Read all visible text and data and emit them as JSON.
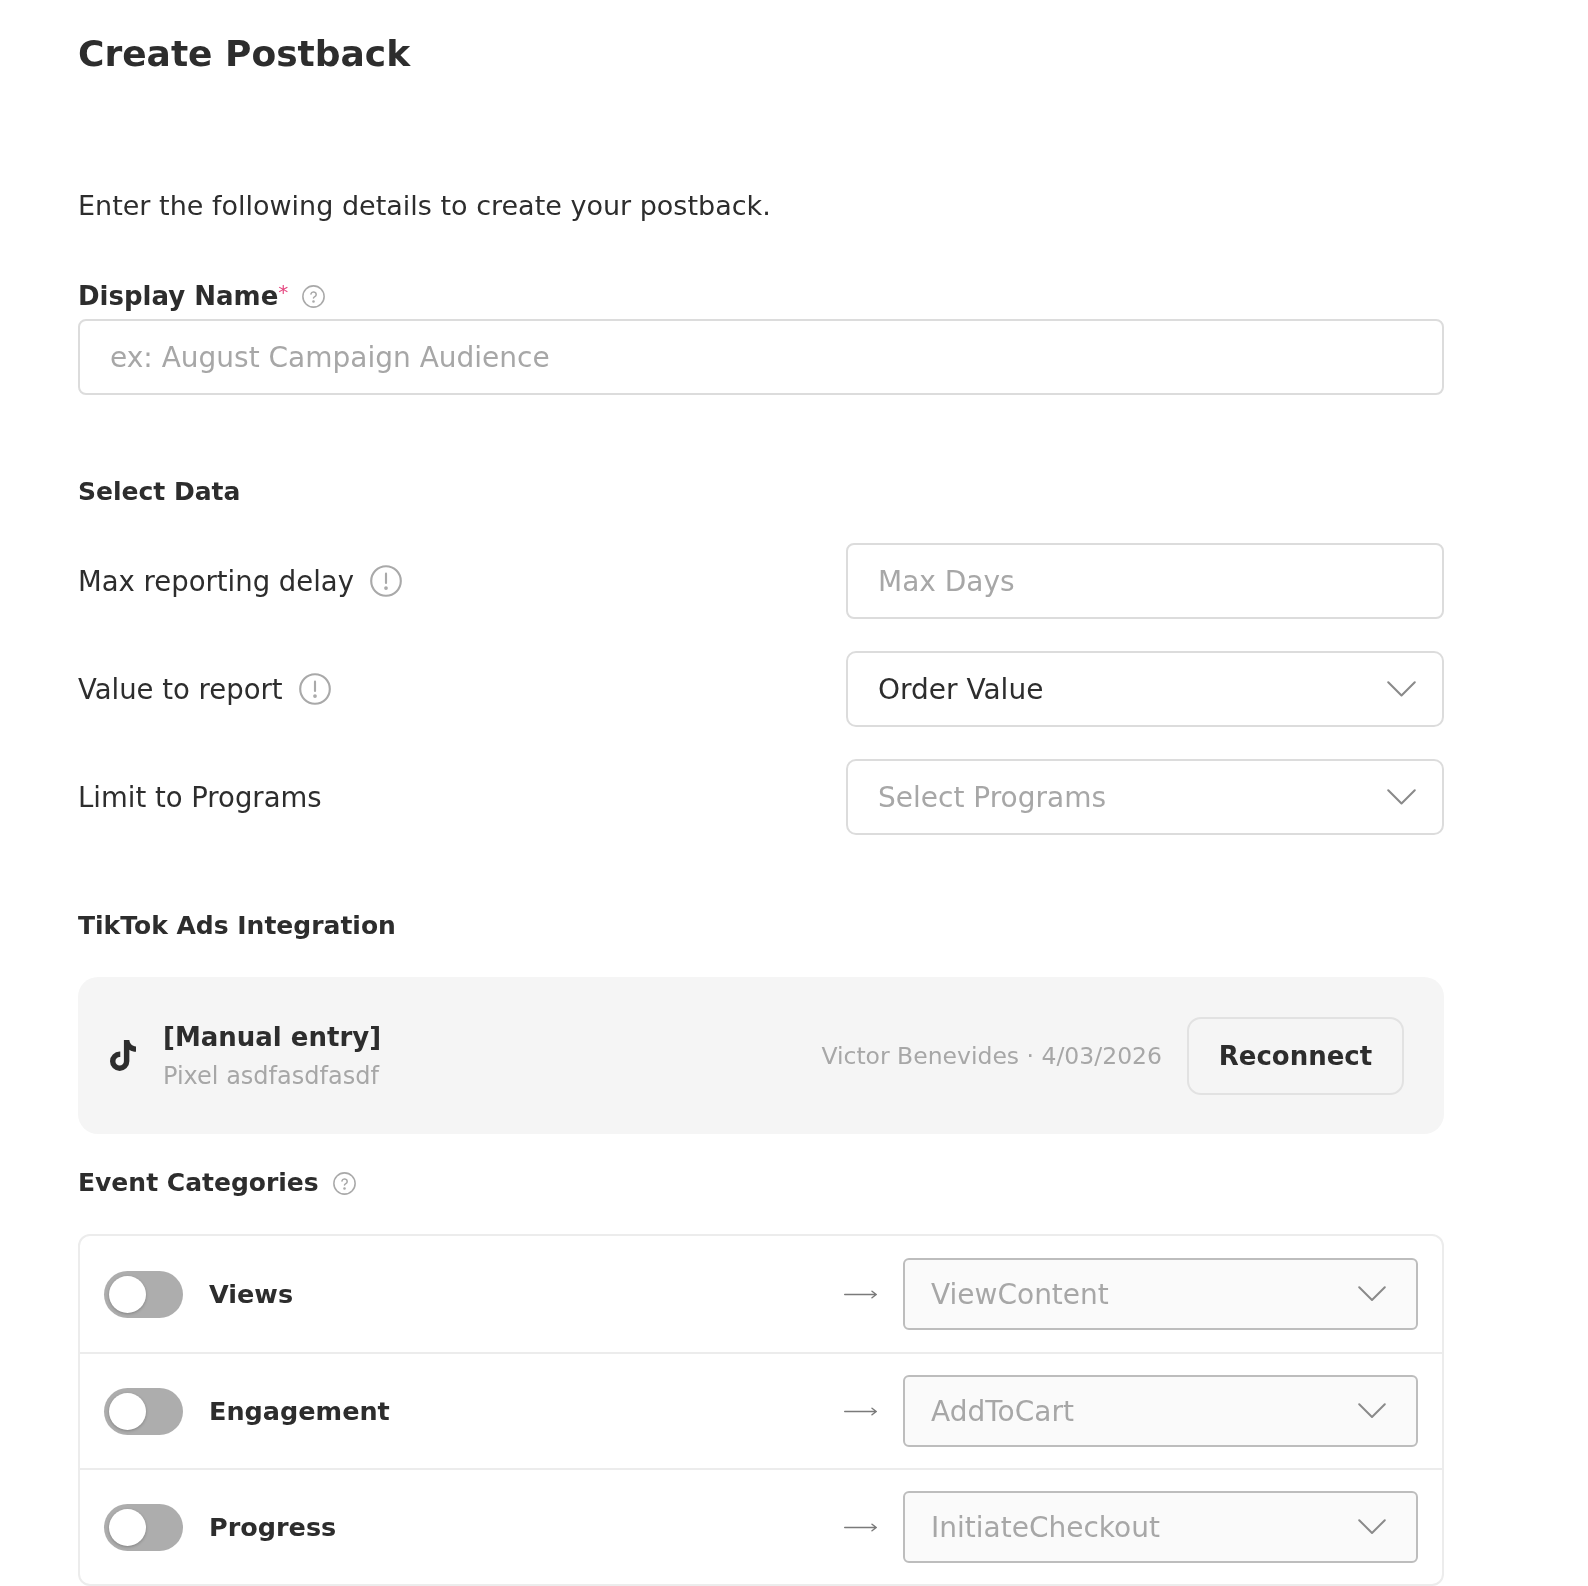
{
  "page": {
    "title": "Create Postback",
    "intro": "Enter the following details to create your postback."
  },
  "display_name": {
    "label": "Display Name",
    "required_mark": "*",
    "placeholder": "ex: August Campaign Audience"
  },
  "select_data": {
    "heading": "Select Data",
    "rows": [
      {
        "label": "Max reporting delay",
        "hint_icon": true,
        "kind": "input",
        "placeholder": "Max Days"
      },
      {
        "label": "Value to report",
        "hint_icon": true,
        "kind": "select",
        "value": "Order Value"
      },
      {
        "label": "Limit to Programs",
        "hint_icon": false,
        "kind": "select",
        "placeholder": "Select Programs"
      }
    ]
  },
  "integration": {
    "heading": "TikTok Ads Integration",
    "name": "[Manual entry]",
    "pixel": "Pixel asdfasdfasdf",
    "connected_by": "Victor Benevides · 4/03/2026",
    "button": "Reconnect"
  },
  "event_categories": {
    "heading": "Event Categories",
    "rows": [
      {
        "label": "Views",
        "on": false,
        "event": "ViewContent",
        "disabled": true
      },
      {
        "label": "Engagement",
        "on": false,
        "event": "AddToCart",
        "disabled": true
      },
      {
        "label": "Progress",
        "on": false,
        "event": "InitiateCheckout",
        "disabled": true
      }
    ]
  }
}
